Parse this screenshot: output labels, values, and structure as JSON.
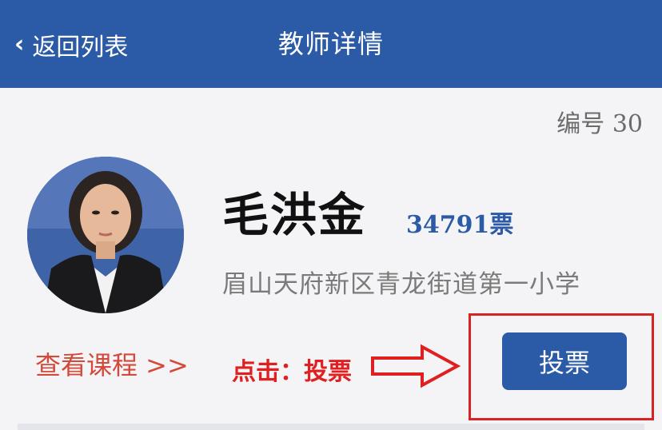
{
  "navbar": {
    "back_label": "返回列表",
    "title": "教师详情",
    "background": "#2b5aa6"
  },
  "teacher": {
    "number_label": "编号 30",
    "name": "毛洪金",
    "votes": "34791票",
    "school": "眉山天府新区青龙街道第一小学"
  },
  "actions": {
    "courses_link": "查看课程 >>",
    "hint": "点击：投票",
    "vote_button": "投票"
  },
  "colors": {
    "accent": "#2b5aa6",
    "highlight": "#d62424",
    "link": "#d44a3a"
  },
  "icons": [
    "chevron-left-icon",
    "right-arrow-icon"
  ]
}
